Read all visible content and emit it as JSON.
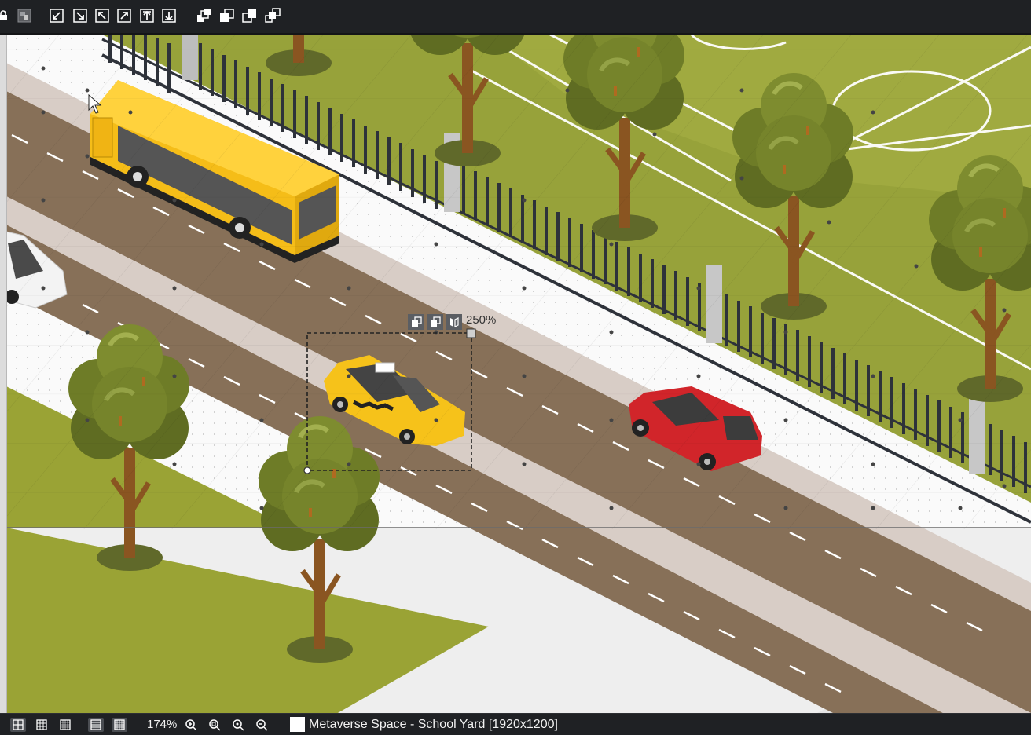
{
  "toolbar": {
    "buttons": [
      {
        "name": "lock-icon"
      },
      {
        "name": "layer-toggle-icon"
      },
      {
        "name": "align-bottom-left-icon"
      },
      {
        "name": "align-bottom-right-icon"
      },
      {
        "name": "align-top-left-icon"
      },
      {
        "name": "align-top-right-icon"
      },
      {
        "name": "move-up-icon"
      },
      {
        "name": "move-down-icon"
      },
      {
        "name": "bring-to-front-icon"
      },
      {
        "name": "bring-forward-icon"
      },
      {
        "name": "send-backward-icon"
      },
      {
        "name": "send-to-back-icon"
      }
    ]
  },
  "selection": {
    "scale_label": "250%",
    "tools": [
      "flip-horizontal-icon",
      "flip-vertical-icon",
      "mirror-icon"
    ]
  },
  "scene": {
    "objects": [
      "school-bus",
      "white-car",
      "taxi",
      "red-car",
      "fence",
      "trees",
      "soccer-field",
      "road"
    ]
  },
  "status": {
    "zoom": "174%",
    "space_title": "Metaverse Space - School Yard [1920x1200]",
    "view_buttons": [
      "grid-view-icon",
      "grid-small-icon",
      "grid-dots-icon",
      "grid-fine-icon",
      "grid-dense-icon"
    ],
    "zoom_buttons": [
      "zoom-in-icon",
      "zoom-fit-icon",
      "zoom-actual-icon",
      "zoom-out-icon"
    ]
  },
  "colors": {
    "grass": "#9aa335",
    "field": "#97a23a",
    "road": "#877058",
    "sidewalk": "#d8cdc6",
    "paving": "#fafafa",
    "fence": "#2e323a",
    "bus": "#f5bd18",
    "taxi": "#f6c21a",
    "red_car": "#d1252a",
    "tree": "#717f29"
  }
}
